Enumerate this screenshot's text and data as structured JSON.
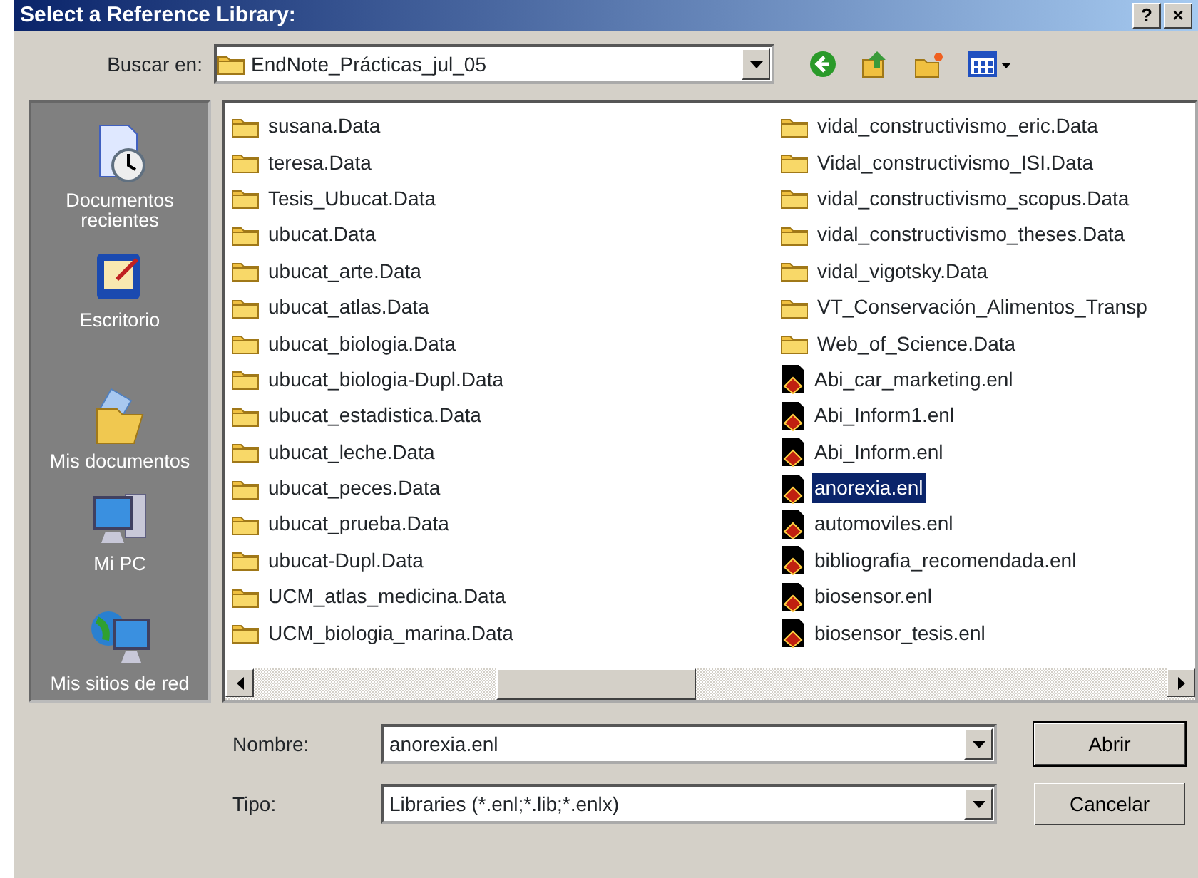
{
  "window": {
    "title": "Select a Reference Library:",
    "title_buttons": [
      "?",
      "×"
    ]
  },
  "look_in": {
    "label": "Buscar en:",
    "value": "EndNote_Prácticas_jul_05"
  },
  "places": [
    {
      "kind": "recent",
      "label": "Documentos recientes"
    },
    {
      "kind": "desktop",
      "label": "Escritorio"
    },
    {
      "kind": "documents",
      "label": "Mis documentos"
    },
    {
      "kind": "computer",
      "label": "Mi PC"
    },
    {
      "kind": "network",
      "label": "Mis sitios de red"
    }
  ],
  "files": [
    {
      "kind": "folder",
      "name": "susana.Data",
      "selected": false
    },
    {
      "kind": "folder",
      "name": "teresa.Data",
      "selected": false
    },
    {
      "kind": "folder",
      "name": "Tesis_Ubucat.Data",
      "selected": false
    },
    {
      "kind": "folder",
      "name": "ubucat.Data",
      "selected": false
    },
    {
      "kind": "folder",
      "name": "ubucat_arte.Data",
      "selected": false
    },
    {
      "kind": "folder",
      "name": "ubucat_atlas.Data",
      "selected": false
    },
    {
      "kind": "folder",
      "name": "ubucat_biologia.Data",
      "selected": false
    },
    {
      "kind": "folder",
      "name": "ubucat_biologia-Dupl.Data",
      "selected": false
    },
    {
      "kind": "folder",
      "name": "ubucat_estadistica.Data",
      "selected": false
    },
    {
      "kind": "folder",
      "name": "ubucat_leche.Data",
      "selected": false
    },
    {
      "kind": "folder",
      "name": "ubucat_peces.Data",
      "selected": false
    },
    {
      "kind": "folder",
      "name": "ubucat_prueba.Data",
      "selected": false
    },
    {
      "kind": "folder",
      "name": "ubucat-Dupl.Data",
      "selected": false
    },
    {
      "kind": "folder",
      "name": "UCM_atlas_medicina.Data",
      "selected": false
    },
    {
      "kind": "folder",
      "name": "UCM_biologia_marina.Data",
      "selected": false
    },
    {
      "kind": "folder",
      "name": "vidal_constructivismo_eric.Data",
      "selected": false
    },
    {
      "kind": "folder",
      "name": "Vidal_constructivismo_ISI.Data",
      "selected": false
    },
    {
      "kind": "folder",
      "name": "vidal_constructivismo_scopus.Data",
      "selected": false
    },
    {
      "kind": "folder",
      "name": "vidal_constructivismo_theses.Data",
      "selected": false
    },
    {
      "kind": "folder",
      "name": "vidal_vigotsky.Data",
      "selected": false
    },
    {
      "kind": "folder",
      "name": "VT_Conservación_Alimentos_Transp",
      "selected": false
    },
    {
      "kind": "folder",
      "name": "Web_of_Science.Data",
      "selected": false
    },
    {
      "kind": "library",
      "name": "Abi_car_marketing.enl",
      "selected": false
    },
    {
      "kind": "library",
      "name": "Abi_Inform1.enl",
      "selected": false
    },
    {
      "kind": "library",
      "name": "Abi_Inform.enl",
      "selected": false
    },
    {
      "kind": "library",
      "name": "anorexia.enl",
      "selected": true
    },
    {
      "kind": "library",
      "name": "automoviles.enl",
      "selected": false
    },
    {
      "kind": "library",
      "name": "bibliografia_recomendada.enl",
      "selected": false
    },
    {
      "kind": "library",
      "name": "biosensor.enl",
      "selected": false
    },
    {
      "kind": "library",
      "name": "biosensor_tesis.enl",
      "selected": false
    }
  ],
  "file_name": {
    "label": "Nombre:",
    "value": "anorexia.enl"
  },
  "file_type": {
    "label": "Tipo:",
    "value": "Libraries (*.enl;*.lib;*.enlx)"
  },
  "buttons": [
    "Abrir",
    "Cancelar"
  ]
}
